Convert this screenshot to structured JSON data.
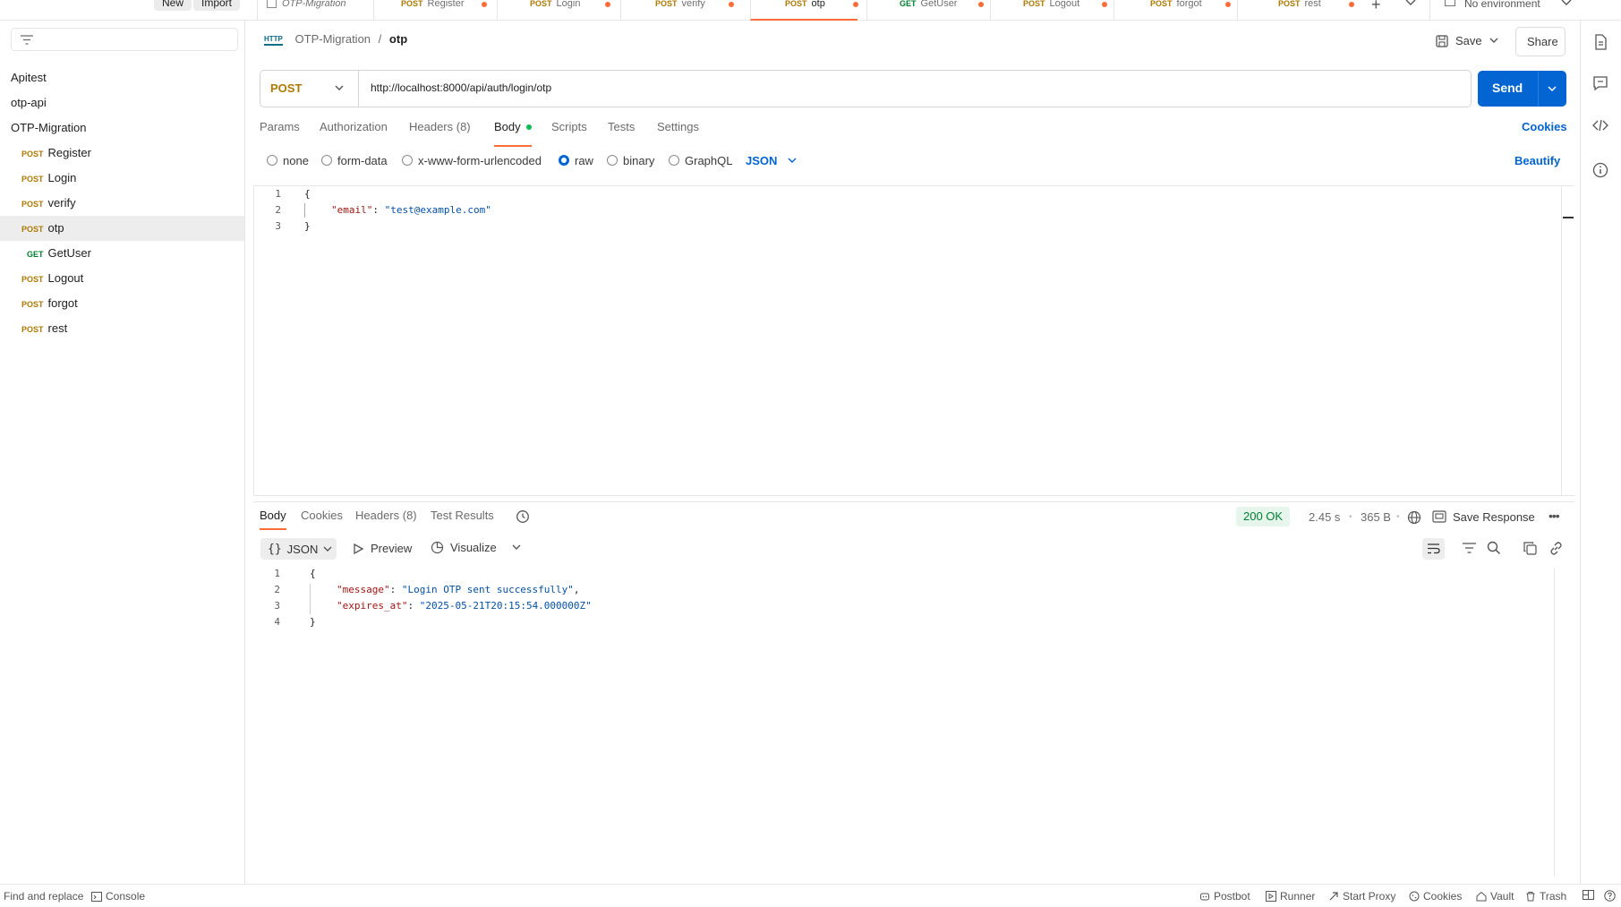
{
  "topbar": {
    "new_label": "New",
    "import_label": "Import",
    "tabs": [
      {
        "method": "",
        "name": "OTP-Migration"
      },
      {
        "method": "POST",
        "name": "Register"
      },
      {
        "method": "POST",
        "name": "Login"
      },
      {
        "method": "POST",
        "name": "verify"
      },
      {
        "method": "POST",
        "name": "otp"
      },
      {
        "method": "GET",
        "name": "GetUser"
      },
      {
        "method": "POST",
        "name": "Logout"
      },
      {
        "method": "POST",
        "name": "forgot"
      },
      {
        "method": "POST",
        "name": "rest"
      }
    ],
    "environment": "No environment"
  },
  "sidebar": {
    "items": [
      {
        "method": "",
        "name": "Apitest"
      },
      {
        "method": "",
        "name": "otp-api"
      },
      {
        "method": "",
        "name": "OTP-Migration"
      },
      {
        "method": "POST",
        "name": "Register"
      },
      {
        "method": "POST",
        "name": "Login"
      },
      {
        "method": "POST",
        "name": "verify"
      },
      {
        "method": "POST",
        "name": "otp"
      },
      {
        "method": "GET",
        "name": "GetUser"
      },
      {
        "method": "POST",
        "name": "Logout"
      },
      {
        "method": "POST",
        "name": "forgot"
      },
      {
        "method": "POST",
        "name": "rest"
      }
    ]
  },
  "request": {
    "collection": "OTP-Migration",
    "separator": "/",
    "name": "otp",
    "save_label": "Save",
    "share_label": "Share",
    "method": "POST",
    "url": "http://localhost:8000/api/auth/login/otp",
    "send_label": "Send",
    "tabs": {
      "params": "Params",
      "authorization": "Authorization",
      "headers": "Headers (8)",
      "body": "Body",
      "scripts": "Scripts",
      "tests": "Tests",
      "settings": "Settings"
    },
    "cookies_label": "Cookies",
    "body_types": {
      "none": "none",
      "form_data": "form-data",
      "urlencoded": "x-www-form-urlencoded",
      "raw": "raw",
      "binary": "binary",
      "graphql": "GraphQL"
    },
    "format": "JSON",
    "beautify_label": "Beautify",
    "body_lines": {
      "n1": "1",
      "n2": "2",
      "n3": "3",
      "l1": "{",
      "l2_key": "\"email\"",
      "l2_sep": ": ",
      "l2_val": "\"test@example.com\"",
      "l3": "}"
    }
  },
  "response": {
    "tabs": {
      "body": "Body",
      "cookies": "Cookies",
      "headers": "Headers (8)",
      "test_results": "Test Results"
    },
    "status": "200 OK",
    "time": "2.45 s",
    "size": "365 B",
    "save_response_label": "Save Response",
    "format": "JSON",
    "preview_label": "Preview",
    "visualize_label": "Visualize",
    "body_lines": {
      "n1": "1",
      "n2": "2",
      "n3": "3",
      "n4": "4",
      "l1": "{",
      "l2_key": "\"message\"",
      "l2_sep": ": ",
      "l2_val": "\"Login OTP sent successfully\"",
      "l2_comma": ",",
      "l3_key": "\"expires_at\"",
      "l3_sep": ": ",
      "l3_val": "\"2025-05-21T20:15:54.000000Z\"",
      "l4": "}"
    }
  },
  "statusbar": {
    "find_replace": "Find and replace",
    "console": "Console",
    "postbot": "Postbot",
    "runner": "Runner",
    "start_proxy": "Start Proxy",
    "cookies": "Cookies",
    "vault": "Vault",
    "trash": "Trash"
  },
  "colors": {
    "accent": "#ff6c37",
    "send": "#0265d2",
    "post": "#ad7a03",
    "get": "#007f31",
    "status_ok": "#007f31"
  }
}
